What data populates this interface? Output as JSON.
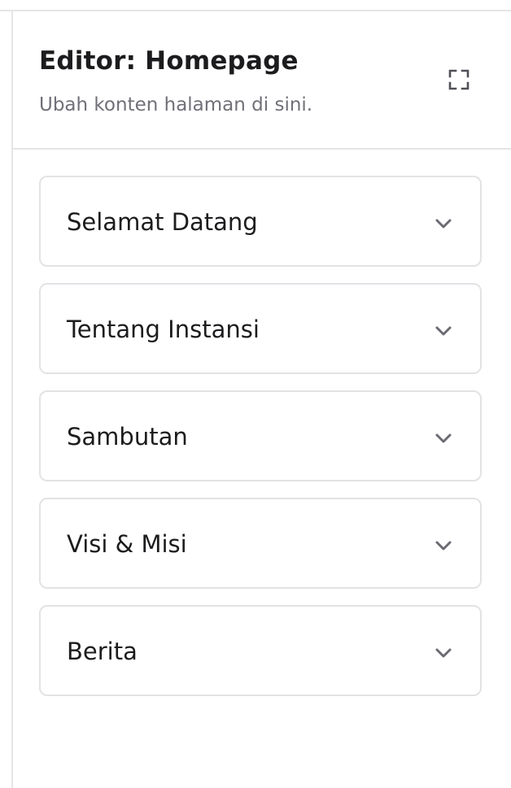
{
  "header": {
    "title": "Editor: Homepage",
    "subtitle": "Ubah konten halaman di sini.",
    "expand_icon": "expand-icon"
  },
  "sections": [
    {
      "label": "Selamat Datang",
      "icon": "chevron-down-icon"
    },
    {
      "label": "Tentang Instansi",
      "icon": "chevron-down-icon"
    },
    {
      "label": "Sambutan",
      "icon": "chevron-down-icon"
    },
    {
      "label": "Visi & Misi",
      "icon": "chevron-down-icon"
    },
    {
      "label": "Berita",
      "icon": "chevron-down-icon"
    }
  ],
  "colors": {
    "border": "#e3e3e6",
    "text": "#1c1c1e",
    "muted": "#707078",
    "icon": "#6b6b73"
  }
}
